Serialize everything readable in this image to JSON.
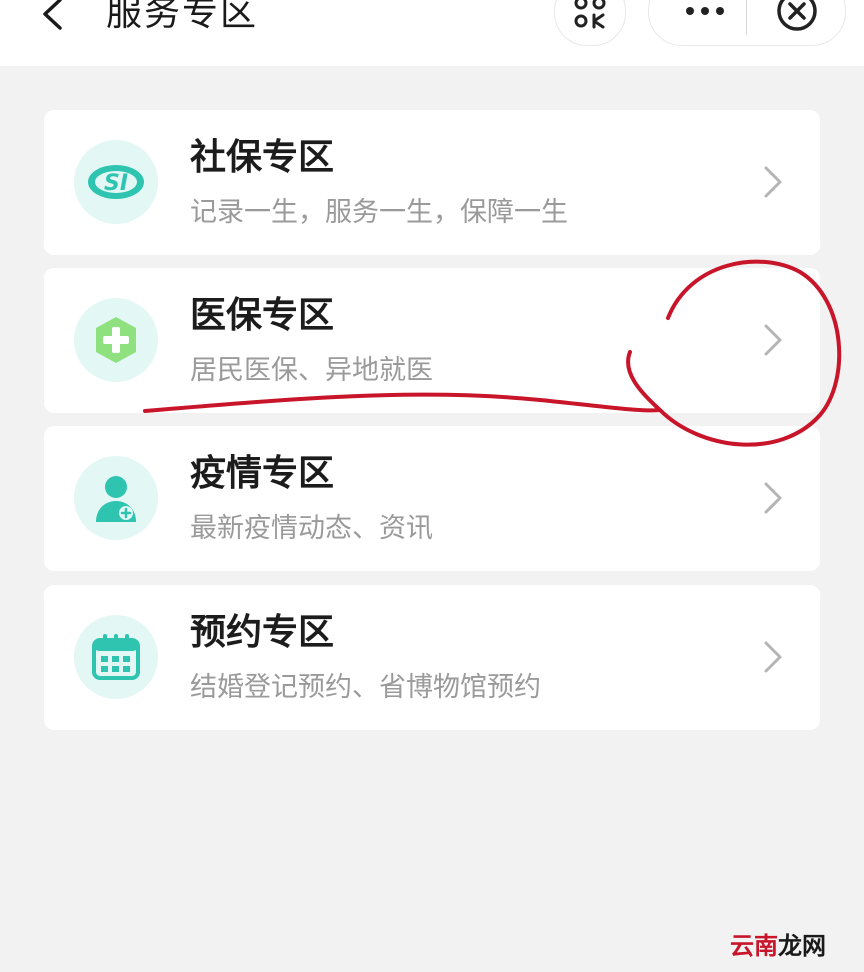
{
  "header": {
    "title": "服务专区",
    "back_icon": "chevron-left-icon",
    "scan_icon": "scan-icon",
    "more_icon": "more-dots-icon",
    "close_icon": "close-circle-icon"
  },
  "cards": [
    {
      "title": "社保专区",
      "subtitle": "记录一生，服务一生，保障一生",
      "icon": "social-security-si-icon"
    },
    {
      "title": "医保专区",
      "subtitle": "居民医保、异地就医",
      "icon": "medical-cross-icon"
    },
    {
      "title": "疫情专区",
      "subtitle": "最新疫情动态、资讯",
      "icon": "doctor-icon"
    },
    {
      "title": "预约专区",
      "subtitle": "结婚登记预约、省博物馆预约",
      "icon": "calendar-icon"
    }
  ],
  "colors": {
    "background": "#f2f2f2",
    "card": "#ffffff",
    "icon_background": "#e3f7f5",
    "accent_teal": "#2ec4b0",
    "accent_green": "#8fe07e",
    "annotation_red": "#c8152a"
  },
  "watermark": {
    "part1": "云南",
    "part2": "龙网"
  }
}
